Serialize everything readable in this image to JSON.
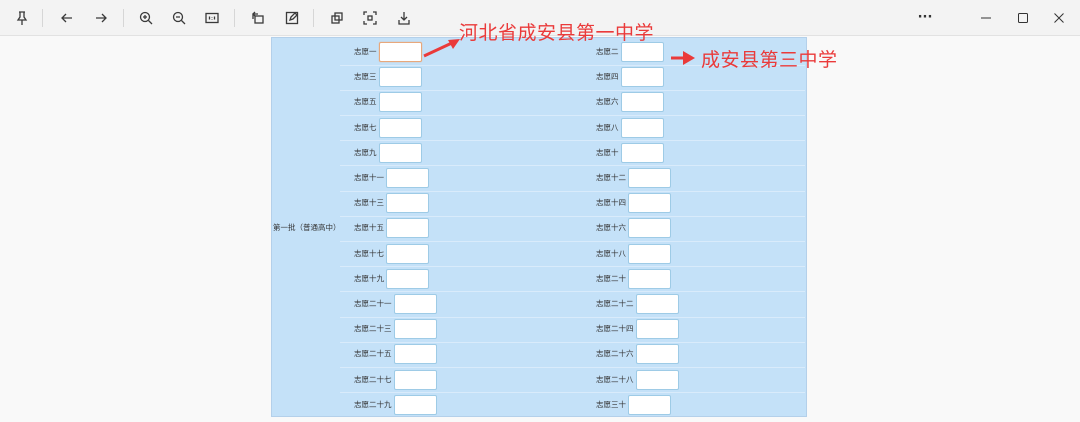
{
  "toolbar": {
    "left_icons": [
      "pin-icon",
      "back-arrow-icon",
      "forward-arrow-icon",
      "zoom-in-icon",
      "zoom-out-icon",
      "actual-size-icon",
      "rotate-icon",
      "edit-icon",
      "crop-icon",
      "fit-icon",
      "save-icon"
    ],
    "more_label": "···",
    "window_icons": [
      "minimize-icon",
      "maximize-icon",
      "close-icon"
    ]
  },
  "form": {
    "group_label": "第一批（普通高中）",
    "choices_left": [
      "志愿一",
      "志愿三",
      "志愿五",
      "志愿七",
      "志愿九",
      "志愿十一",
      "志愿十三",
      "志愿十五",
      "志愿十七",
      "志愿十九",
      "志愿二十一",
      "志愿二十三",
      "志愿二十五",
      "志愿二十七",
      "志愿二十九"
    ],
    "choices_right": [
      "志愿二",
      "志愿四",
      "志愿六",
      "志愿八",
      "志愿十",
      "志愿十二",
      "志愿十四",
      "志愿十六",
      "志愿十八",
      "志愿二十",
      "志愿二十二",
      "志愿二十四",
      "志愿二十六",
      "志愿二十八",
      "志愿三十"
    ]
  },
  "annotations": {
    "left": "河北省成安县第一中学",
    "right": "成安县第三中学",
    "color": "#ea3a3a"
  },
  "colors": {
    "form_background": "#c4e1f8",
    "input_border": "#9ecbe6"
  }
}
